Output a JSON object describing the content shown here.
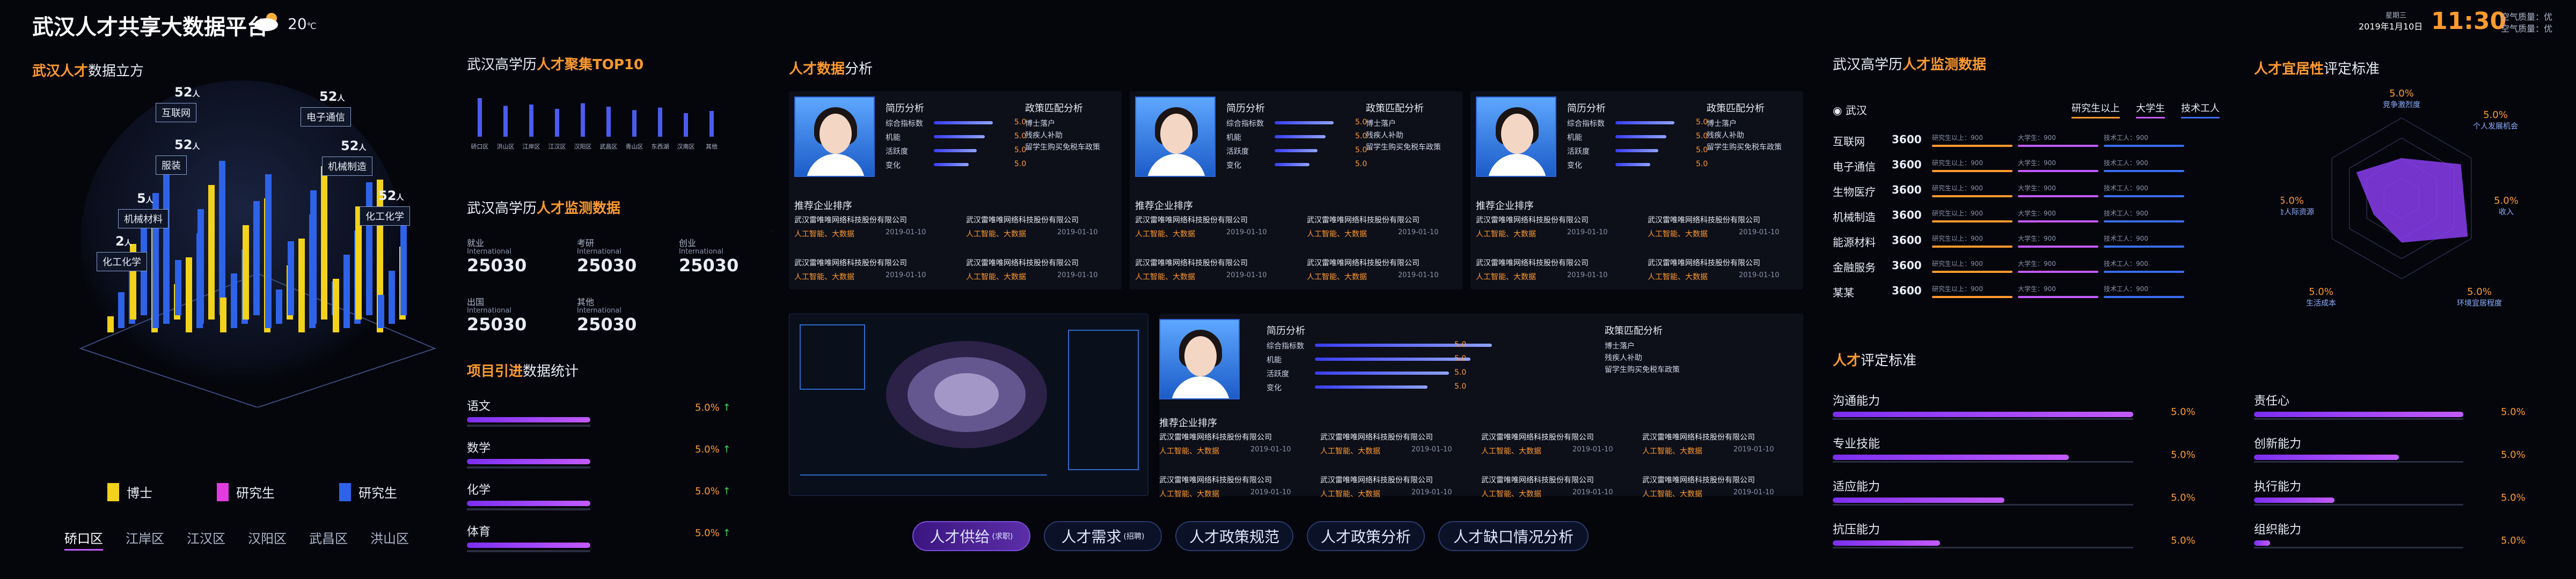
{
  "header": {
    "title": "武汉人才共享大数据平台",
    "temp": "20",
    "temp_unit": "℃",
    "week": "星期三",
    "date": "2019年1月10日",
    "time": "11:30",
    "air_label": "空气质量：",
    "air_value": "优",
    "air2_label": "空气质量：",
    "air2_value": "优"
  },
  "left": {
    "title_hl": "武汉人才",
    "title_rest": "数据立方",
    "tags": [
      {
        "value": "52",
        "unit": "人",
        "label": "互联网"
      },
      {
        "value": "52",
        "unit": "人",
        "label": "服装"
      },
      {
        "value": "5",
        "unit": "人",
        "label": "机械材料"
      },
      {
        "value": "2",
        "unit": "人",
        "label": "化工化学"
      },
      {
        "value": "52",
        "unit": "人",
        "label": "电子通信"
      },
      {
        "value": "52",
        "unit": "人",
        "label": "机械制造"
      },
      {
        "value": "52",
        "unit": "人",
        "label": "化工化学"
      }
    ],
    "legend": [
      "博士",
      "研究生",
      "研究生"
    ],
    "districts": [
      "硚口区",
      "江岸区",
      "江汉区",
      "汉阳区",
      "武昌区",
      "洪山区"
    ]
  },
  "top10": {
    "title_pre": "武汉高学历",
    "title_hl": "人才聚集TOP10",
    "values": [
      0.9,
      0.72,
      0.75,
      0.65,
      0.78,
      0.7,
      0.62,
      0.68,
      0.55,
      0.6
    ],
    "labels": [
      "硚口区",
      "洪山区",
      "江岸区",
      "江汉区",
      "汉阳区",
      "武昌区",
      "青山区",
      "东西湖",
      "汉南区",
      "其他"
    ]
  },
  "monitor": {
    "title_pre": "武汉高学历",
    "title_hl": "人才监测数据",
    "items": [
      {
        "label": "就业",
        "sub": "International",
        "value": "25030"
      },
      {
        "label": "考研",
        "sub": "International",
        "value": "25030"
      },
      {
        "label": "创业",
        "sub": "International",
        "value": "25030"
      },
      {
        "label": "出国",
        "sub": "International",
        "value": "25030"
      },
      {
        "label": "其他",
        "sub": "International",
        "value": "25030"
      }
    ]
  },
  "intro": {
    "title_hl": "项目引进",
    "title_rest": "数据统计",
    "items": [
      {
        "label": "语文",
        "value": "5.0%"
      },
      {
        "label": "数学",
        "value": "5.0%"
      },
      {
        "label": "化学",
        "value": "5.0%"
      },
      {
        "label": "体育",
        "value": "5.0%"
      }
    ]
  },
  "talent": {
    "title_hl": "人才数据",
    "title_rest": "分析",
    "resume_title": "简历分析",
    "policy_title": "政策匹配分析",
    "metrics": [
      {
        "label": "综合指标数",
        "value": "5.0"
      },
      {
        "label": "机能",
        "value": "5.0"
      },
      {
        "label": "活跃度",
        "value": "5.0"
      },
      {
        "label": "变化",
        "value": "5.0"
      }
    ],
    "policies": [
      "博士落户",
      "残疾人补助",
      "留学生购买免税车政策"
    ],
    "rec_title": "推荐企业排序",
    "company": "武汉雷唯唯网络科技股份有限公司",
    "tags": "人工智能、大数据",
    "date": "2019-01-10"
  },
  "city": {
    "title_pre": "武汉高学历",
    "title_hl": "人才监测数据",
    "location": "武汉",
    "legend": [
      "研究生以上",
      "大学生",
      "技术工人"
    ],
    "rows": [
      {
        "label": "互联网",
        "value": "3600"
      },
      {
        "label": "电子通信",
        "value": "3600"
      },
      {
        "label": "生物医疗",
        "value": "3600"
      },
      {
        "label": "机械制造",
        "value": "3600"
      },
      {
        "label": "能源材料",
        "value": "3600"
      },
      {
        "label": "金融服务",
        "value": "3600"
      },
      {
        "label": "某某",
        "value": "3600"
      }
    ],
    "sublabels": [
      "研究生以上",
      "大学生",
      "技术工人"
    ],
    "subvalue": "900"
  },
  "radar": {
    "title_hl": "人才宜居性",
    "title_rest": "评定标准",
    "items": [
      {
        "label": "竞争激烈度",
        "value": "5.0%"
      },
      {
        "label": "个人发展机会",
        "value": "5.0%"
      },
      {
        "label": "收入",
        "value": "5.0%"
      },
      {
        "label": "环境宜居程度",
        "value": "5.0%"
      },
      {
        "label": "生活成本",
        "value": "5.0%"
      },
      {
        "label": "社会人际资源",
        "value": "5.0%"
      }
    ]
  },
  "standard": {
    "title_hl": "人才",
    "title_rest": "评定标准",
    "left": [
      {
        "label": "沟通能力",
        "value": "5.0%"
      },
      {
        "label": "专业技能",
        "value": "5.0%"
      },
      {
        "label": "适应能力",
        "value": "5.0%"
      },
      {
        "label": "抗压能力",
        "value": "5.0%"
      }
    ],
    "right": [
      {
        "label": "责任心",
        "value": "5.0%"
      },
      {
        "label": "创新能力",
        "value": "5.0%"
      },
      {
        "label": "执行能力",
        "value": "5.0%"
      },
      {
        "label": "组织能力",
        "value": "5.0%"
      }
    ]
  },
  "nav": [
    {
      "label": "人才供给",
      "sub": "(求职)"
    },
    {
      "label": "人才需求",
      "sub": "(招聘)"
    },
    {
      "label": "人才政策规范",
      "sub": ""
    },
    {
      "label": "人才政策分析",
      "sub": ""
    },
    {
      "label": "人才缺口情况分析",
      "sub": ""
    }
  ]
}
